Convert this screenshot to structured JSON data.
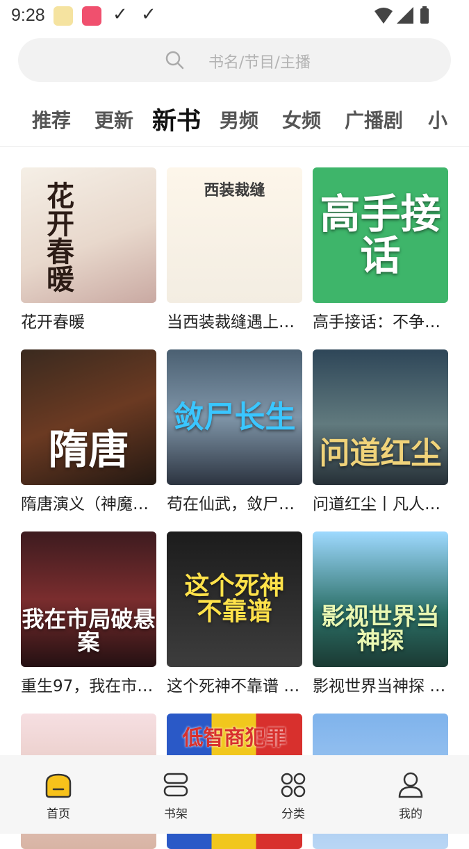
{
  "status_bar": {
    "time": "9:28"
  },
  "search": {
    "placeholder": "书名/节目/主播"
  },
  "tabs": [
    {
      "label": "推荐"
    },
    {
      "label": "更新"
    },
    {
      "label": "新书",
      "active": true
    },
    {
      "label": "男频"
    },
    {
      "label": "女频"
    },
    {
      "label": "广播剧"
    },
    {
      "label": "小"
    }
  ],
  "books": [
    {
      "title": "花开春暖",
      "cover_text": "花开春暖"
    },
    {
      "title": "当西装裁缝遇上…",
      "cover_text": "西装裁缝"
    },
    {
      "title": "高手接话：不争…",
      "cover_text": "高手接话"
    },
    {
      "title": "隋唐演义（神魔…",
      "cover_text": "隋唐"
    },
    {
      "title": "苟在仙武，敛尸…",
      "cover_text": "敛尸长生"
    },
    {
      "title": "问道红尘丨凡人…",
      "cover_text": "问道红尘"
    },
    {
      "title": "重生97，我在市…",
      "cover_text": "我在市局破悬案"
    },
    {
      "title": "这个死神不靠谱 …",
      "cover_text": "这个死神不靠谱"
    },
    {
      "title": "影视世界当神探 …",
      "cover_text": "影视世界当神探"
    },
    {
      "title": "",
      "cover_text": ""
    },
    {
      "title": "",
      "cover_text": "低智商犯罪"
    },
    {
      "title": "",
      "cover_text": ""
    }
  ],
  "bottom_nav": [
    {
      "label": "首页",
      "icon": "home-icon",
      "active": true
    },
    {
      "label": "书架",
      "icon": "bookshelf-icon"
    },
    {
      "label": "分类",
      "icon": "category-icon"
    },
    {
      "label": "我的",
      "icon": "profile-icon"
    }
  ],
  "colors": {
    "accent": "#f7c21b",
    "background": "#ffffff"
  }
}
